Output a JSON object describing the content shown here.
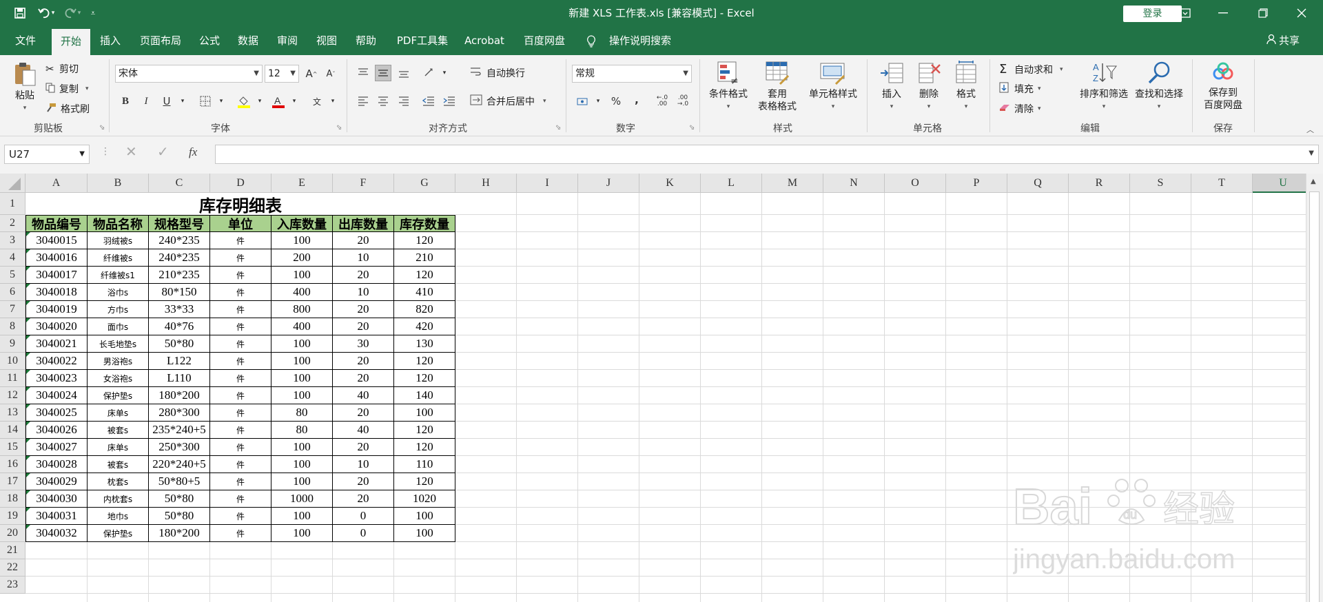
{
  "titlebar": {
    "title": "新建 XLS 工作表.xls  [兼容模式]  -  Excel",
    "login_label": "登录"
  },
  "tabs": [
    {
      "id": "file",
      "label": "文件"
    },
    {
      "id": "home",
      "label": "开始"
    },
    {
      "id": "insert",
      "label": "插入"
    },
    {
      "id": "layout",
      "label": "页面布局"
    },
    {
      "id": "formulas",
      "label": "公式"
    },
    {
      "id": "data",
      "label": "数据"
    },
    {
      "id": "review",
      "label": "审阅"
    },
    {
      "id": "view",
      "label": "视图"
    },
    {
      "id": "help",
      "label": "帮助"
    },
    {
      "id": "pdf",
      "label": "PDF工具集"
    },
    {
      "id": "acrobat",
      "label": "Acrobat"
    },
    {
      "id": "baidu",
      "label": "百度网盘"
    },
    {
      "id": "tell",
      "label": "操作说明搜索"
    }
  ],
  "share_label": "共享",
  "ribbon": {
    "clipboard": {
      "paste": "粘贴",
      "cut": "剪切",
      "copy": "复制",
      "painter": "格式刷",
      "label": "剪贴板"
    },
    "font": {
      "name": "宋体",
      "size": "12",
      "bold": "B",
      "italic": "I",
      "underline": "U",
      "label": "字体",
      "aa_big": "A",
      "aa_small": "A"
    },
    "alignment": {
      "wrap": "自动换行",
      "merge": "合并后居中",
      "label": "对齐方式"
    },
    "number": {
      "format": "常规",
      "percent": "%",
      "comma": ",",
      "inc": ".0 .00",
      "dec": ".00 .0",
      "label": "数字"
    },
    "styles": {
      "cond": "条件格式",
      "table_line1": "套用",
      "table_line2": "表格格式",
      "cell": "单元格样式",
      "label": "样式"
    },
    "cells": {
      "insert": "插入",
      "delete": "删除",
      "format": "格式",
      "label": "单元格"
    },
    "editing": {
      "autosum": "自动求和",
      "fill": "填充",
      "clear": "清除",
      "sort": "排序和筛选",
      "find": "查找和选择",
      "label": "编辑"
    },
    "save": {
      "line1": "保存到",
      "line2": "百度网盘",
      "label": "保存"
    }
  },
  "namebox": "U27",
  "fx_label": "fx",
  "columns": [
    "A",
    "B",
    "C",
    "D",
    "E",
    "F",
    "G",
    "H",
    "I",
    "J",
    "K",
    "L",
    "M",
    "N",
    "O",
    "P",
    "Q",
    "R",
    "S",
    "T",
    "U"
  ],
  "selected_column": "U",
  "rows": [
    "1",
    "2",
    "3",
    "4",
    "5",
    "6",
    "7",
    "8",
    "9",
    "10",
    "11",
    "12",
    "13",
    "14",
    "15",
    "16",
    "17",
    "18",
    "19",
    "20",
    "21",
    "22",
    "23"
  ],
  "sheet": {
    "title": "库存明细表",
    "headers": [
      "物品编号",
      "物品名称",
      "规格型号",
      "单位",
      "入库数量",
      "出库数量",
      "库存数量"
    ],
    "records": [
      [
        "3040015",
        "羽绒被s",
        "240*235",
        "件",
        "100",
        "20",
        "120"
      ],
      [
        "3040016",
        "纤维被s",
        "240*235",
        "件",
        "200",
        "10",
        "210"
      ],
      [
        "3040017",
        "纤维被s1",
        "210*235",
        "件",
        "100",
        "20",
        "120"
      ],
      [
        "3040018",
        "浴巾s",
        "80*150",
        "件",
        "400",
        "10",
        "410"
      ],
      [
        "3040019",
        "方巾s",
        "33*33",
        "件",
        "800",
        "20",
        "820"
      ],
      [
        "3040020",
        "面巾s",
        "40*76",
        "件",
        "400",
        "20",
        "420"
      ],
      [
        "3040021",
        "长毛地垫s",
        "50*80",
        "件",
        "100",
        "30",
        "130"
      ],
      [
        "3040022",
        "男浴袍s",
        "L122",
        "件",
        "100",
        "20",
        "120"
      ],
      [
        "3040023",
        "女浴袍s",
        "L110",
        "件",
        "100",
        "20",
        "120"
      ],
      [
        "3040024",
        "保护垫s",
        "180*200",
        "件",
        "100",
        "40",
        "140"
      ],
      [
        "3040025",
        "床单s",
        "280*300",
        "件",
        "80",
        "20",
        "100"
      ],
      [
        "3040026",
        "被套s",
        "235*240+5",
        "件",
        "80",
        "40",
        "120"
      ],
      [
        "3040027",
        "床单s",
        "250*300",
        "件",
        "100",
        "20",
        "120"
      ],
      [
        "3040028",
        "被套s",
        "220*240+5",
        "件",
        "100",
        "10",
        "110"
      ],
      [
        "3040029",
        "枕套s",
        "50*80+5",
        "件",
        "100",
        "20",
        "120"
      ],
      [
        "3040030",
        "内枕套s",
        "50*80",
        "件",
        "1000",
        "20",
        "1020"
      ],
      [
        "3040031",
        "地巾s",
        "50*80",
        "件",
        "100",
        "0",
        "100"
      ],
      [
        "3040032",
        "保护垫s",
        "180*200",
        "件",
        "100",
        "0",
        "100"
      ]
    ]
  },
  "watermark": {
    "brand": "Bai",
    "brand2": "经验",
    "url": "jingyan.baidu.com"
  },
  "colors": {
    "excel_green": "#217346",
    "header_fill": "#a9d18e"
  }
}
